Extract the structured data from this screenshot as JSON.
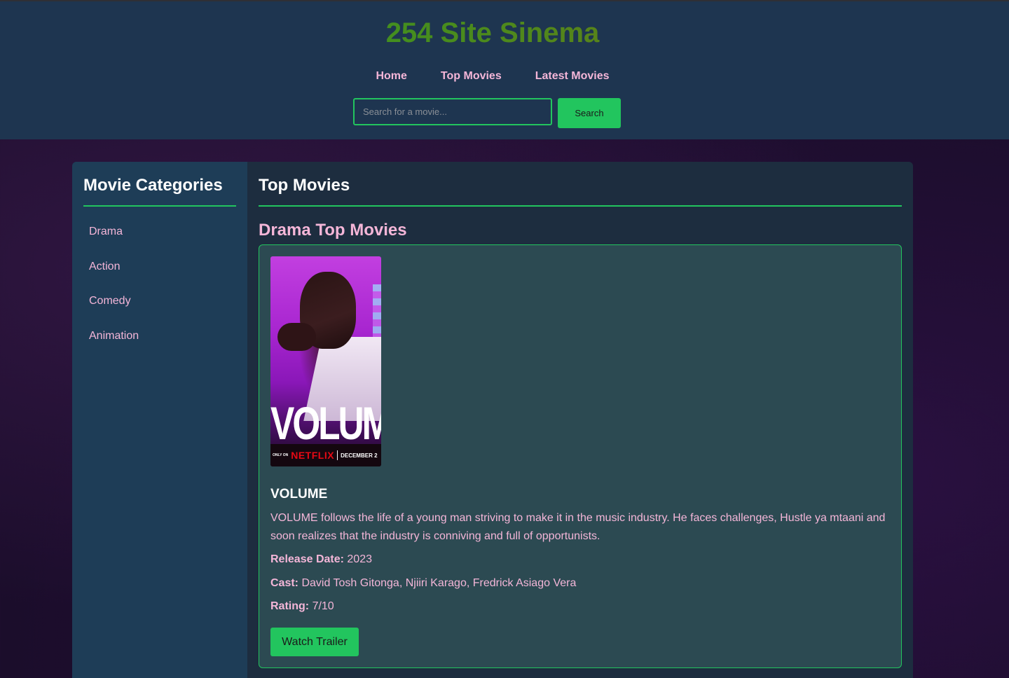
{
  "header": {
    "site_title": "254 Site Sinema",
    "nav": [
      {
        "label": "Home"
      },
      {
        "label": "Top Movies"
      },
      {
        "label": "Latest Movies"
      }
    ],
    "search": {
      "placeholder": "Search for a movie...",
      "value": "",
      "button_label": "Search"
    }
  },
  "sidebar": {
    "title": "Movie Categories",
    "categories": [
      {
        "label": "Drama"
      },
      {
        "label": "Action"
      },
      {
        "label": "Comedy"
      },
      {
        "label": "Animation"
      }
    ]
  },
  "main": {
    "title": "Top Movies",
    "section_title": "Drama Top Movies",
    "movie": {
      "poster": {
        "title_text": "VOLUME",
        "only_on": "ONLY ON",
        "brand": "NETFLIX",
        "date": "DECEMBER 2"
      },
      "title": "VOLUME",
      "description": "VOLUME follows the life of a young man striving to make it in the music industry. He faces challenges, Hustle ya mtaani and soon realizes that the industry is conniving and full of opportunists.",
      "release_label": "Release Date:",
      "release_value": "2023",
      "cast_label": "Cast:",
      "cast_value": "David Tosh Gitonga, Njiiri Karago, Fredrick Asiago Vera",
      "rating_label": "Rating:",
      "rating_value": "7/10",
      "trailer_label": "Watch Trailer"
    }
  },
  "colors": {
    "accent": "#22c55e",
    "link_pink": "#f4b6d8",
    "header_bg": "#1e3550"
  }
}
